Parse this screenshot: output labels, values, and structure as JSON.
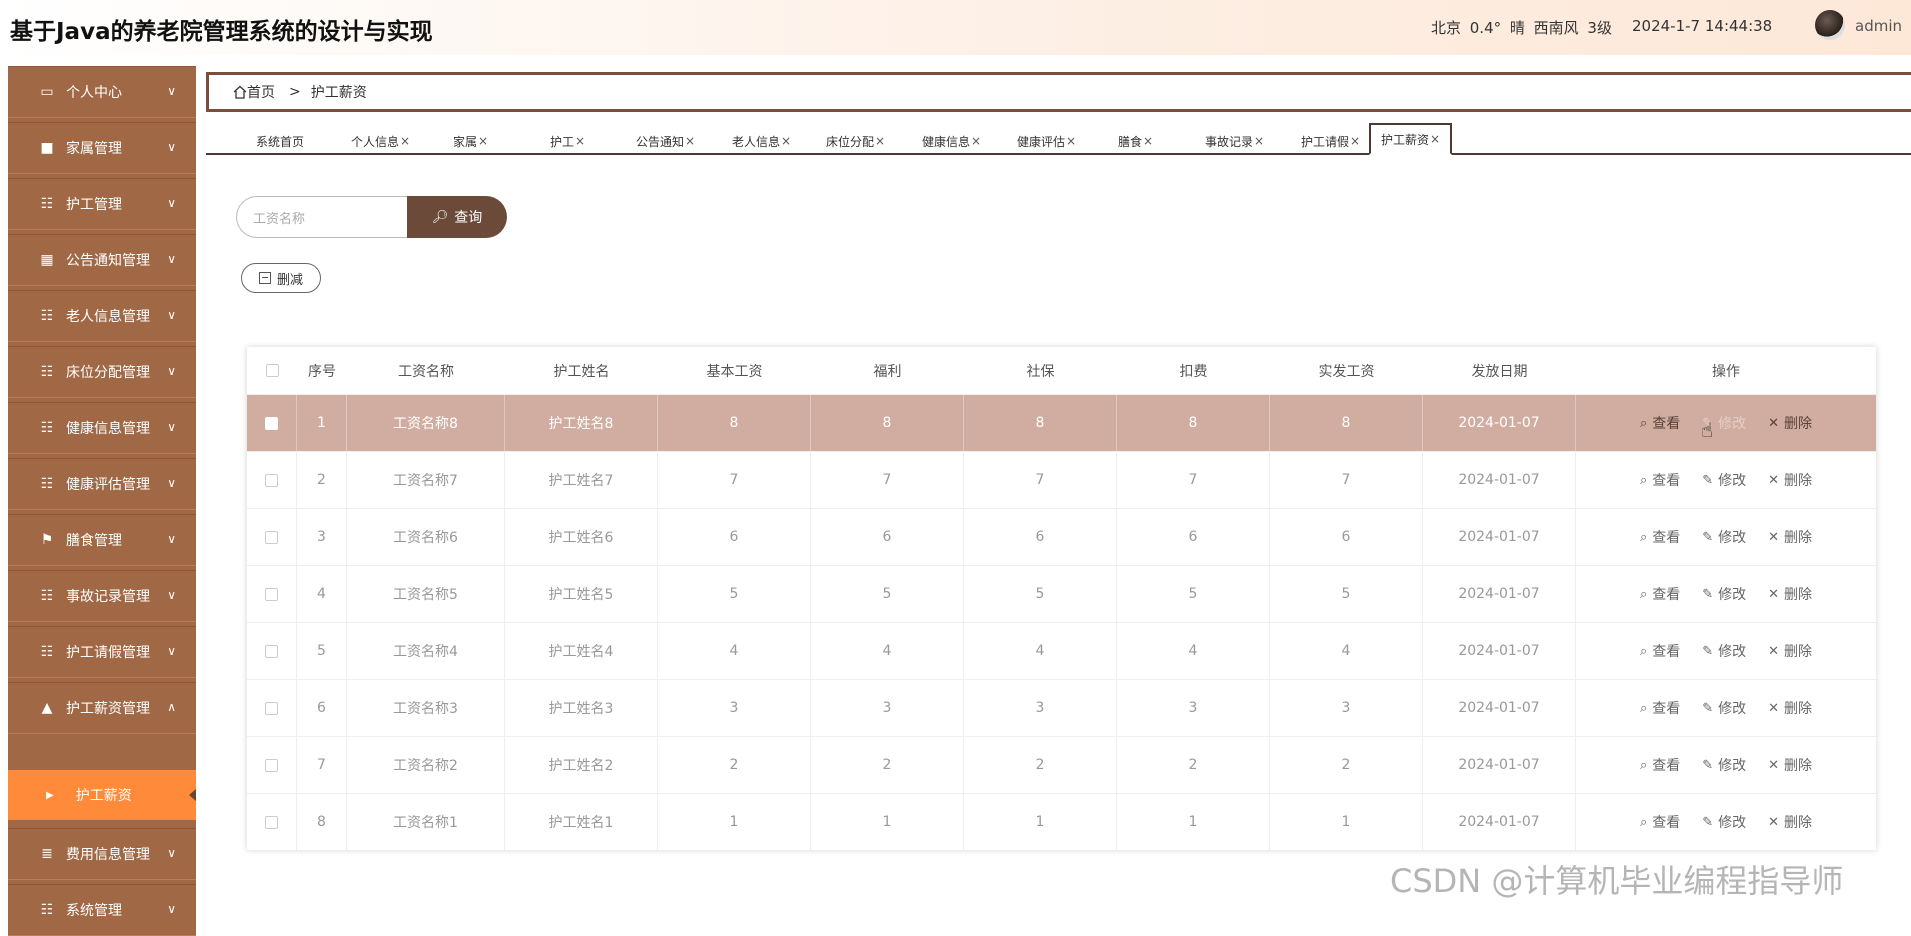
{
  "header": {
    "title": "基于Java的养老院管理系统的设计与实现",
    "weather": "北京  0.4°  晴  西南风  3级",
    "datetime": "2024-1-7 14:44:38",
    "user": "admin"
  },
  "sidebar": {
    "items": [
      {
        "label": "个人中心",
        "icon": "card-icon"
      },
      {
        "label": "家属管理",
        "icon": "briefcase-icon"
      },
      {
        "label": "护工管理",
        "icon": "grid-icon"
      },
      {
        "label": "公告通知管理",
        "icon": "chart-icon"
      },
      {
        "label": "老人信息管理",
        "icon": "grid-icon"
      },
      {
        "label": "床位分配管理",
        "icon": "grid-icon"
      },
      {
        "label": "健康信息管理",
        "icon": "table-icon"
      },
      {
        "label": "健康评估管理",
        "icon": "grid-icon"
      },
      {
        "label": "膳食管理",
        "icon": "flag-icon"
      },
      {
        "label": "事故记录管理",
        "icon": "grid-icon"
      },
      {
        "label": "护工请假管理",
        "icon": "grid-icon"
      },
      {
        "label": "护工薪资管理",
        "icon": "user-icon"
      },
      {
        "label": "费用信息管理",
        "icon": "sliders-icon"
      },
      {
        "label": "系统管理",
        "icon": "grid-icon"
      }
    ],
    "active_sub": "护工薪资"
  },
  "breadcrumb": {
    "home": "首页",
    "current": "护工薪资"
  },
  "tabs": [
    "系统首页",
    "个人信息",
    "家属",
    "护工",
    "公告通知",
    "老人信息",
    "床位分配",
    "健康信息",
    "健康评估",
    "膳食",
    "事故记录",
    "护工请假",
    "护工薪资"
  ],
  "search": {
    "placeholder": "工资名称",
    "button": "查询"
  },
  "delete_button": "删减",
  "table": {
    "headers": [
      "序号",
      "工资名称",
      "护工姓名",
      "基本工资",
      "福利",
      "社保",
      "扣费",
      "实发工资",
      "发放日期",
      "操作"
    ],
    "rows": [
      [
        "1",
        "工资名称8",
        "护工姓名8",
        "8",
        "8",
        "8",
        "8",
        "8",
        "2024-01-07"
      ],
      [
        "2",
        "工资名称7",
        "护工姓名7",
        "7",
        "7",
        "7",
        "7",
        "7",
        "2024-01-07"
      ],
      [
        "3",
        "工资名称6",
        "护工姓名6",
        "6",
        "6",
        "6",
        "6",
        "6",
        "2024-01-07"
      ],
      [
        "4",
        "工资名称5",
        "护工姓名5",
        "5",
        "5",
        "5",
        "5",
        "5",
        "2024-01-07"
      ],
      [
        "5",
        "工资名称4",
        "护工姓名4",
        "4",
        "4",
        "4",
        "4",
        "4",
        "2024-01-07"
      ],
      [
        "6",
        "工资名称3",
        "护工姓名3",
        "3",
        "3",
        "3",
        "3",
        "3",
        "2024-01-07"
      ],
      [
        "7",
        "工资名称2",
        "护工姓名2",
        "2",
        "2",
        "2",
        "2",
        "2",
        "2024-01-07"
      ],
      [
        "8",
        "工资名称1",
        "护工姓名1",
        "1",
        "1",
        "1",
        "1",
        "1",
        "2024-01-07"
      ]
    ],
    "actions": {
      "view": "查看",
      "edit": "修改",
      "delete": "删除"
    }
  },
  "watermark": "CSDN @计算机毕业编程指导师",
  "colors": {
    "sidebar": "#a16846",
    "active": "#ff8a3a",
    "highlight_row": "#d0ada0",
    "button": "#6b4a3a"
  }
}
